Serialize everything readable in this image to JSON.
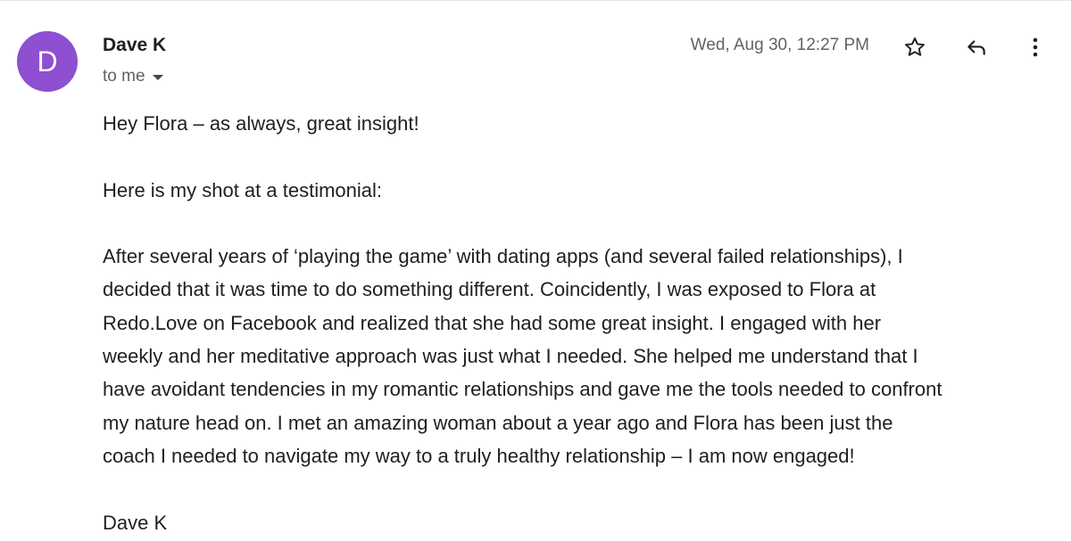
{
  "sender": {
    "avatar_letter": "D",
    "avatar_color": "#8e4fd0",
    "name": "Dave K",
    "recipient_label": "to me"
  },
  "date": "Wed, Aug 30, 12:27 PM",
  "actions": {
    "star_icon": "star-outline-icon",
    "reply_icon": "reply-arrow-icon",
    "more_icon": "vertical-dots-icon"
  },
  "body": {
    "greeting": "Hey Flora – as always, great insight!",
    "intro": "Here is my shot at a testimonial:",
    "testimonial_lines": [
      "After several years of ‘playing the game’ with dating apps (and several failed relationships), I",
      "decided that it was time to do something different.  Coincidently, I was exposed to Flora at",
      "Redo.Love on Facebook and realized that she had some great insight.  I engaged with her",
      "weekly and her meditative approach was just what I needed.  She helped me understand that I",
      "have avoidant tendencies in my romantic relationships and gave me the tools needed to confront",
      "my nature head on.  I met an amazing woman about a year ago and Flora has been just the",
      "coach I needed to navigate my way to a truly healthy relationship – I am now engaged!"
    ],
    "signature": "Dave K"
  }
}
